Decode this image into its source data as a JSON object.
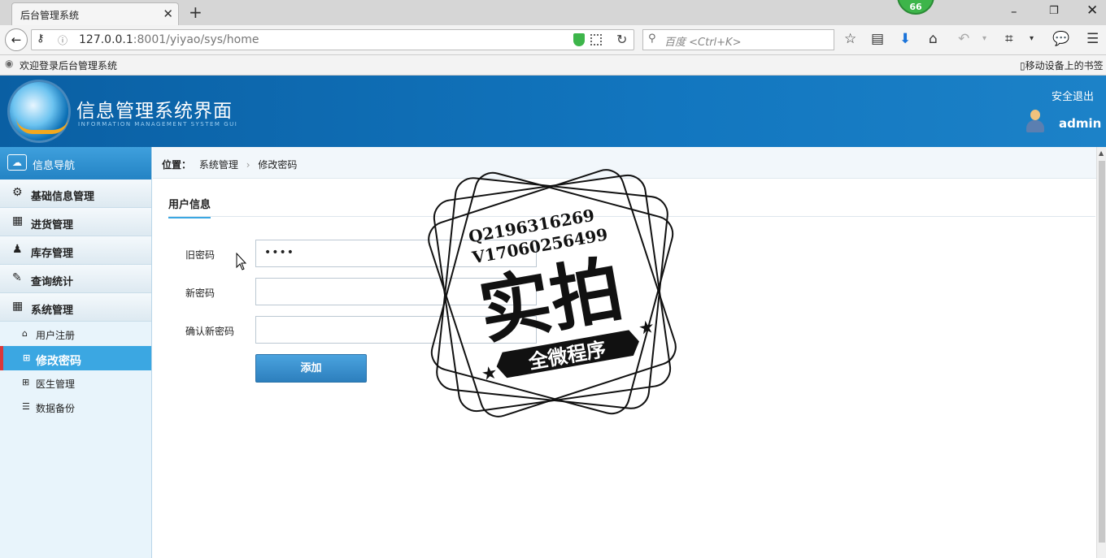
{
  "browser": {
    "tab_title": "后台管理系统",
    "tab_close": "✕",
    "new_tab": "+",
    "counter_badge": "66",
    "url_host": "127.0.0.1",
    "url_rest": ":8001/yiyao/sys/home",
    "search_placeholder": "百度 <Ctrl+K>",
    "bookmark_left": "欢迎登录后台管理系统",
    "bookmark_right": "移动设备上的书签",
    "icons": [
      "back-arrow-icon",
      "key-icon",
      "info-icon",
      "shield-icon",
      "qr-icon",
      "reload-icon",
      "search-icon",
      "star-icon",
      "reader-icon",
      "download-icon",
      "home-icon",
      "undo-icon",
      "crop-icon",
      "chat-icon",
      "menu-icon"
    ]
  },
  "header": {
    "brand": "信息管理系统界面",
    "brand_sub": "INFORMATION MANAGEMENT SYSTEM GUI",
    "logout": "安全退出",
    "user": "admin"
  },
  "sidebar": {
    "title": "信息导航",
    "menus": [
      {
        "label": "基础信息管理",
        "icon": "gears-icon"
      },
      {
        "label": "进货管理",
        "icon": "calendar-icon"
      },
      {
        "label": "库存管理",
        "icon": "user-icon"
      },
      {
        "label": "查询统计",
        "icon": "edit-icon"
      },
      {
        "label": "系统管理",
        "icon": "calendar-icon"
      }
    ],
    "subitems": [
      {
        "label": "用户注册",
        "icon": "home-icon"
      },
      {
        "label": "修改密码",
        "icon": "grid-icon",
        "active": true
      },
      {
        "label": "医生管理",
        "icon": "grid-icon"
      },
      {
        "label": "数据备份",
        "icon": "list-icon"
      }
    ]
  },
  "main": {
    "crumb_label": "位置：",
    "crumb_1": "系统管理",
    "crumb_2": "修改密码",
    "section_title": "用户信息",
    "fields": [
      {
        "label": "旧密码",
        "value": "••••"
      },
      {
        "label": "新密码",
        "value": ""
      },
      {
        "label": "确认新密码",
        "value": ""
      }
    ],
    "submit": "添加"
  },
  "watermark": {
    "line1": "Q2196316269",
    "line2": "V17060256499",
    "big": "实拍",
    "ribbon": "全微程序"
  },
  "colors": {
    "header_blue": "#0a5fa3",
    "accent_blue": "#3ba7e2",
    "active_marker": "#d9383a"
  }
}
